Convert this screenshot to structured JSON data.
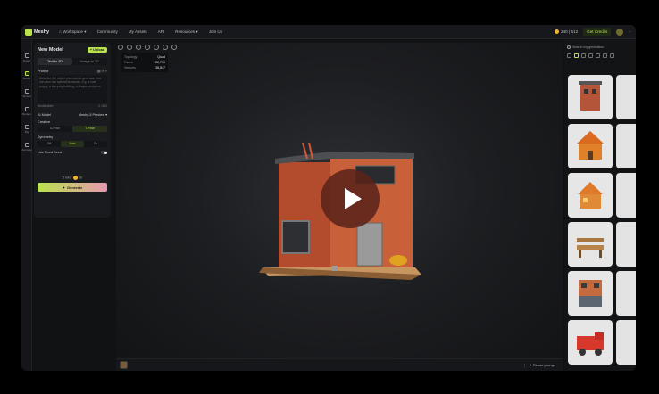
{
  "topbar": {
    "brand": "Meshy",
    "workspace": "Workspace",
    "nav": [
      "Community",
      "My Assets",
      "API",
      "Resources",
      "Join Us"
    ],
    "credits": "240 | 612",
    "get_credits": "Get Credits"
  },
  "rail": [
    {
      "label": "Image",
      "icon": "image-icon"
    },
    {
      "label": "Model",
      "icon": "cube-icon"
    },
    {
      "label": "Texture",
      "icon": "brush-icon"
    },
    {
      "label": "Retopo",
      "icon": "mesh-icon"
    },
    {
      "label": "Rig",
      "icon": "bone-icon"
    },
    {
      "label": "Animate",
      "icon": "run-icon"
    }
  ],
  "panel": {
    "title": "New Model",
    "new_button": "+ Upload",
    "tabs": [
      "Text to 3D",
      "Image to 3D"
    ],
    "prompt_label": "Prompt",
    "prompt_placeholder": "Describe the object you want to generate. You can also use special keywords, e.g. a cute puppy, a low-poly building, a dragon sculpture.",
    "prompt_footer_left": "Worldbuilder",
    "prompt_footer_right": "0 / 800",
    "ai_model_label": "AI Model",
    "ai_model_value": "Meshy-5 Preview",
    "creative_label": "Creative",
    "creative_options": [
      "A-Pose",
      "T-Pose"
    ],
    "symmetry_label": "Symmetry",
    "symmetry_options": [
      "Off",
      "Auto",
      "On"
    ],
    "free_retry_label": "Use Fixed Seed",
    "credit_text": "5 mins",
    "credit_cost": "10",
    "generate_label": "Generate"
  },
  "viewport": {
    "stats": [
      {
        "k": "Topology",
        "v": "Quad"
      },
      {
        "k": "Faces",
        "v": "22,770"
      },
      {
        "k": "Vertices",
        "v": "38,847"
      }
    ],
    "bottom_right": "Reuse prompt"
  },
  "gallery": {
    "search_placeholder": "Search my generation",
    "items": [
      "brick-building",
      "orange-house",
      "orange-house-2",
      "park-bench",
      "shop-building",
      "fire-truck"
    ]
  },
  "colors": {
    "accent": "#b9e24b",
    "background": "#111214"
  }
}
